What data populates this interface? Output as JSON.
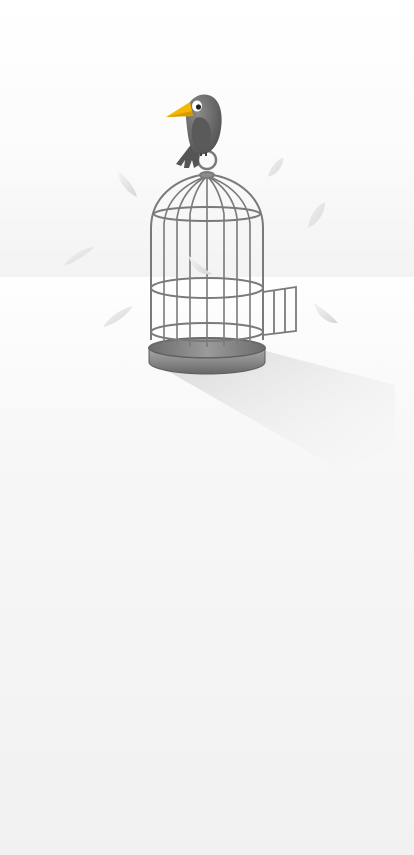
{
  "scene": {
    "subject": "bird-on-empty-birdcage",
    "icons": [
      "bird-icon",
      "birdcage-icon",
      "feather-icon"
    ],
    "colors": {
      "wall_top": "#ffffff",
      "floor": "#f2f2f2",
      "bird_body": "#6b6b6b",
      "bird_beak": "#f5b800",
      "cage_wire": "#7a7a7a",
      "cage_base": "#8c8c8c",
      "feather": "#e4e4e4"
    }
  }
}
